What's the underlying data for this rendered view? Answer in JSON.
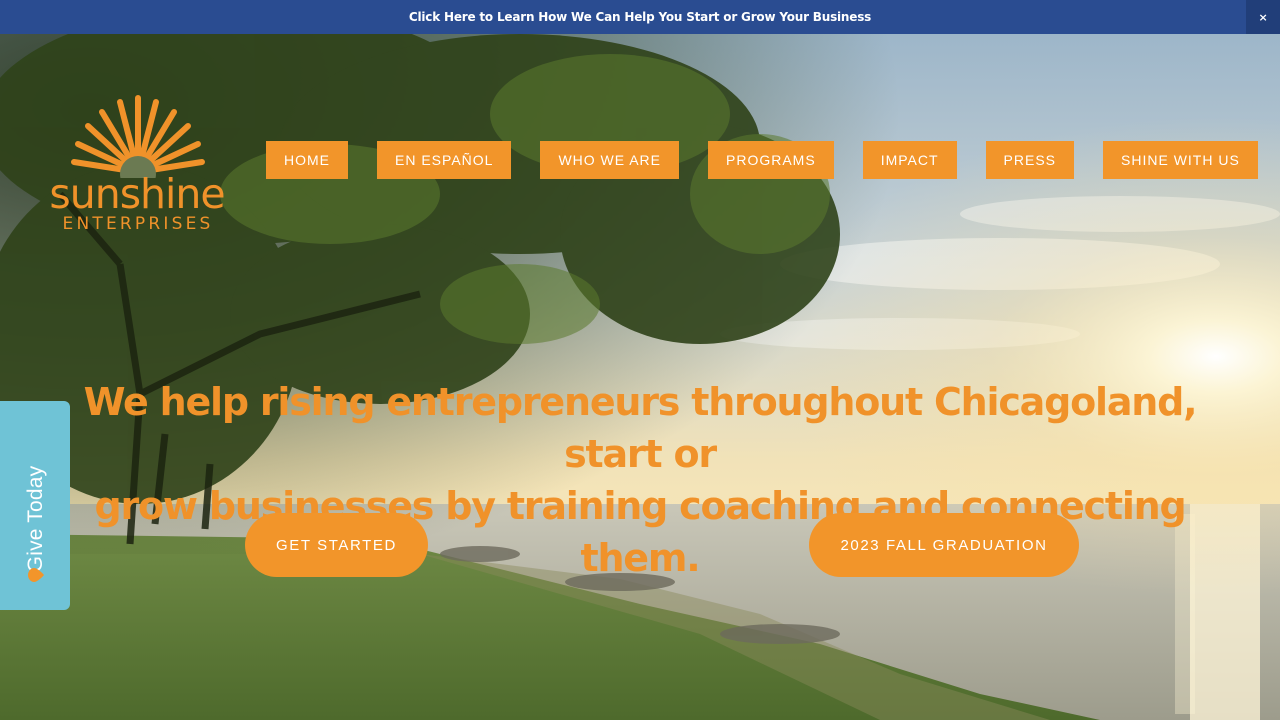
{
  "announcement": {
    "text": "Click Here to Learn How We Can Help You Start or Grow Your Business",
    "close_label": "×"
  },
  "logo": {
    "name": "sunshine",
    "subtitle": "ENTERPRISES"
  },
  "nav": {
    "items": [
      {
        "label": "HOME"
      },
      {
        "label": "EN ESPAÑOL"
      },
      {
        "label": "WHO WE ARE"
      },
      {
        "label": "PROGRAMS"
      },
      {
        "label": "IMPACT"
      },
      {
        "label": "PRESS"
      },
      {
        "label": "SHINE WITH US"
      }
    ]
  },
  "hero": {
    "headline_line1": "We help rising entrepreneurs throughout Chicagoland, start or",
    "headline_line2": "grow businesses by training coaching and connecting them.",
    "cta_primary": "GET STARTED",
    "cta_secondary": "2023 FALL GRADUATION"
  },
  "donate_tab": {
    "label": "Give Today",
    "icon": "heart-icon"
  },
  "colors": {
    "brand_orange": "#f2952a",
    "announce_blue": "#2a4c91",
    "donate_teal": "#6fc3d6"
  }
}
